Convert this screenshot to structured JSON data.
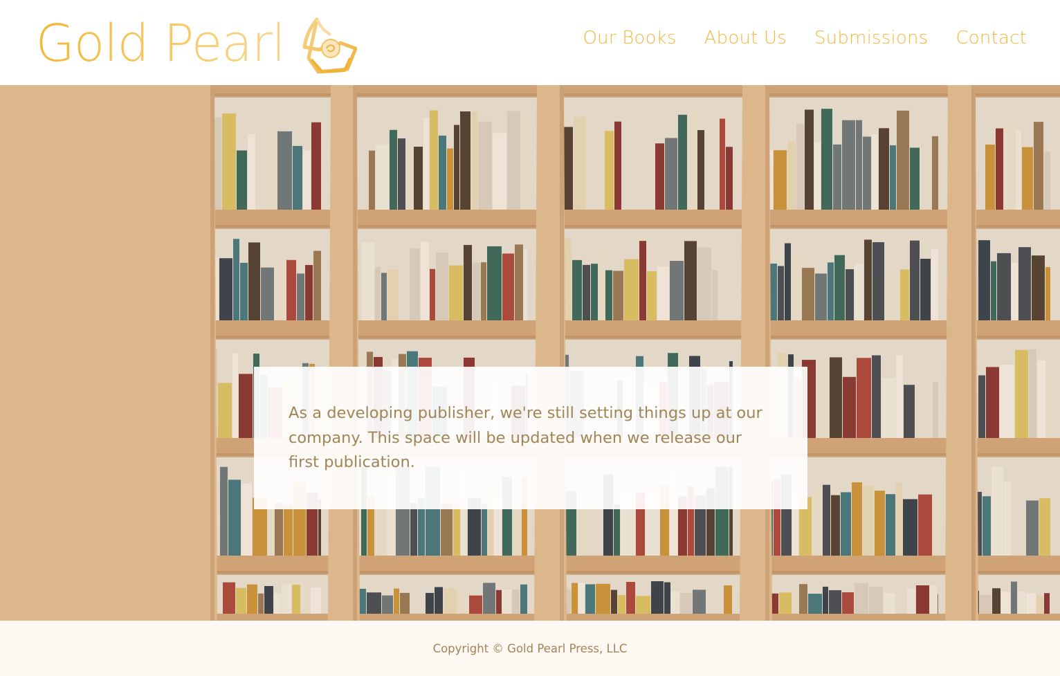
{
  "brand": {
    "name": "Gold Pearl",
    "accent_color": "#f3b73b",
    "text_color": "#a08556"
  },
  "nav": {
    "items": [
      {
        "label": "Our Books"
      },
      {
        "label": "About Us"
      },
      {
        "label": "Submissions"
      },
      {
        "label": "Contact"
      }
    ]
  },
  "hero": {
    "image": "bookshelf-photo",
    "notice_text": "As a developing publisher, we're still setting things up at our company. This space will be updated when we release our first publication."
  },
  "footer": {
    "copyright": "Copyright © Gold Pearl Press, LLC"
  }
}
